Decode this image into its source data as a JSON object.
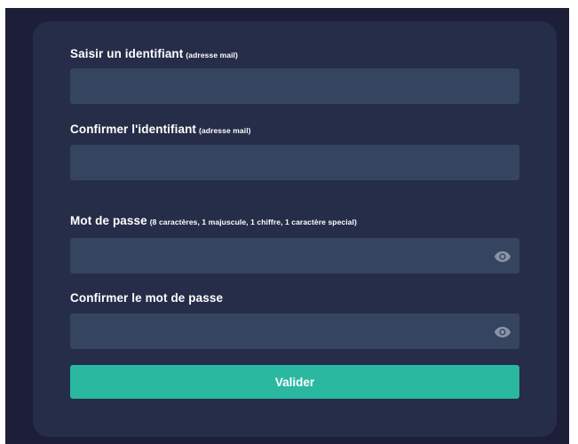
{
  "form": {
    "identifiant": {
      "label": "Saisir un identifiant",
      "hint": "(adresse mail)",
      "value": ""
    },
    "confirm_identifiant": {
      "label": "Confirmer l'identifiant",
      "hint": "(adresse mail)",
      "value": ""
    },
    "password": {
      "label": "Mot de passe",
      "hint": "(8 caractères, 1 majuscule, 1 chiffre, 1 caractère special)",
      "value": ""
    },
    "confirm_password": {
      "label": "Confirmer le mot de passe",
      "value": ""
    },
    "submit_label": "Valider"
  },
  "icons": {
    "password_toggle": "eye-icon",
    "confirm_password_toggle": "eye-icon"
  },
  "colors": {
    "background": "#1c1f37",
    "card": "#262d48",
    "input": "#354560",
    "accent": "#2bb8a1",
    "text": "#ffffff",
    "icon": "#8a93a6"
  }
}
